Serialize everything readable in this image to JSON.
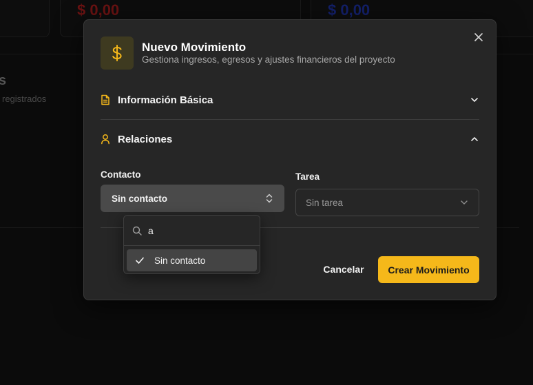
{
  "background": {
    "amount_left": "$ 0,00",
    "amount_right": "$ 0,00",
    "section_title_fragment": "s",
    "section_sub_fragment": "registrados"
  },
  "modal": {
    "title": "Nuevo Movimiento",
    "subtitle": "Gestiona ingresos, egresos y ajustes financieros del proyecto",
    "header_icon": "dollar-sign-icon",
    "sections": [
      {
        "label": "Información Básica",
        "icon": "document-icon",
        "expanded": false
      },
      {
        "label": "Relaciones",
        "icon": "user-icon",
        "expanded": true
      }
    ],
    "contact": {
      "label": "Contacto",
      "value": "Sin contacto"
    },
    "task": {
      "label": "Tarea",
      "value": "Sin tarea"
    },
    "cancel_label": "Cancelar",
    "create_label": "Crear Movimiento"
  },
  "dropdown": {
    "search_value": "a",
    "options": [
      {
        "label": "Sin contacto",
        "selected": true
      }
    ]
  },
  "colors": {
    "accent": "#f5b81a",
    "modal_bg": "#262626",
    "page_bg": "#0b0b0b",
    "negative": "#6a1212",
    "positive": "#13206a"
  }
}
